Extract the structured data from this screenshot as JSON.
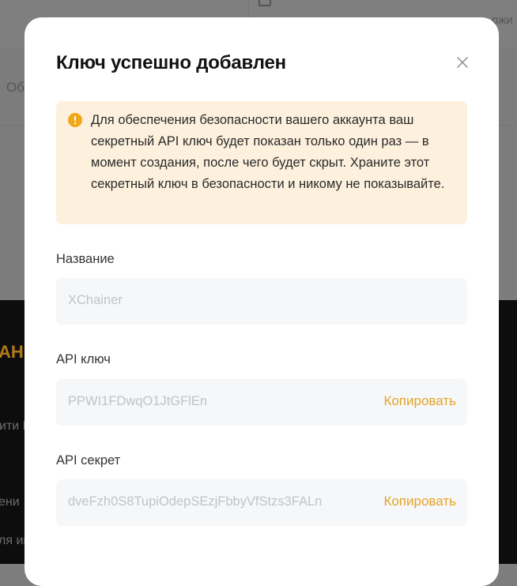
{
  "background": {
    "top_text": "ржи",
    "row_text": "Об",
    "section_heading": "АН",
    "line1": "ити В",
    "line2": "ени",
    "line3": "ля ин"
  },
  "modal": {
    "title": "Ключ успешно добавлен",
    "notice": {
      "text": "Для обеспечения безопасности вашего аккаунта ваш секретный API ключ будет показан только один раз — в момент создания, после чего будет скрыт. Храните этот секретный ключ в безопасности и никому не показывайте."
    },
    "fields": {
      "name": {
        "label": "Название",
        "value": "XChainer"
      },
      "api_key": {
        "label": "API ключ",
        "value": "PPWI1FDwqO1JtGFlEn",
        "copy_label": "Копировать"
      },
      "api_secret": {
        "label": "API секрет",
        "value": "dveFzh0S8TupiOdepSEzjFbbyVfStzs3FALn",
        "copy_label": "Копировать"
      }
    }
  },
  "colors": {
    "accent": "#e3a327",
    "notice_bg": "#fdf1de",
    "field_bg": "#f6f7f9",
    "overlay": "#7d7d7d"
  }
}
